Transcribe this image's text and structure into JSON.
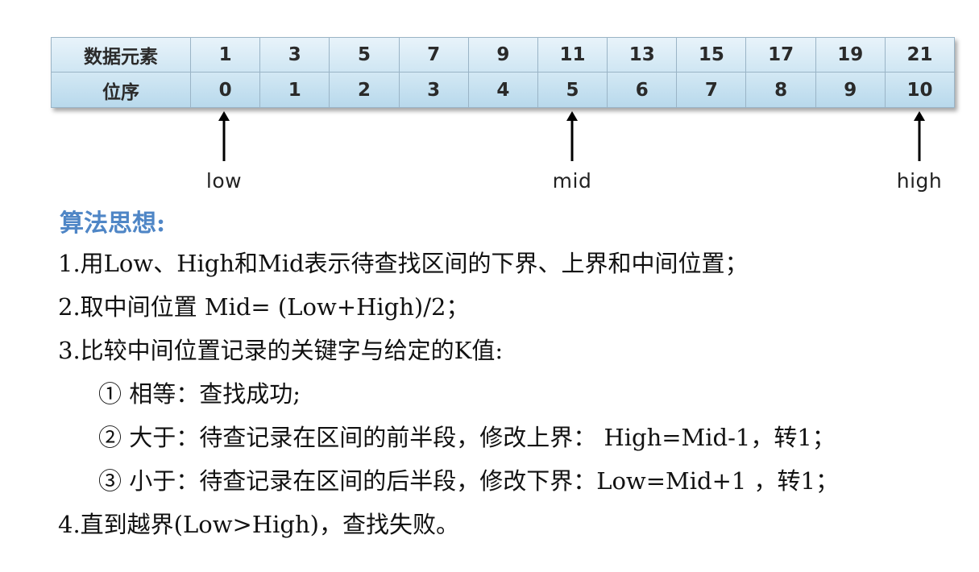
{
  "table": {
    "row1_header": "数据元素",
    "row2_header": "位序",
    "values": [
      "1",
      "3",
      "5",
      "7",
      "9",
      "11",
      "13",
      "15",
      "17",
      "19",
      "21"
    ],
    "indices": [
      "0",
      "1",
      "2",
      "3",
      "4",
      "5",
      "6",
      "7",
      "8",
      "9",
      "10"
    ]
  },
  "pointers": {
    "low": "low",
    "mid": "mid",
    "high": "high"
  },
  "algorithm": {
    "heading": "算法思想:",
    "steps": [
      "1.用Low、High和Mid表示待查找区间的下界、上界和中间位置；",
      "2.取中间位置 Mid= (Low+High)/2；",
      "3.比较中间位置记录的关键字与给定的K值:",
      "① 相等：查找成功;",
      "② 大于：待查记录在区间的前半段，修改上界： High=Mid-1，转1；",
      "③ 小于：待查记录在区间的后半段，修改下界：Low=Mid+1 ，转1；",
      "4.直到越界(Low>High)，查找失败。"
    ]
  }
}
